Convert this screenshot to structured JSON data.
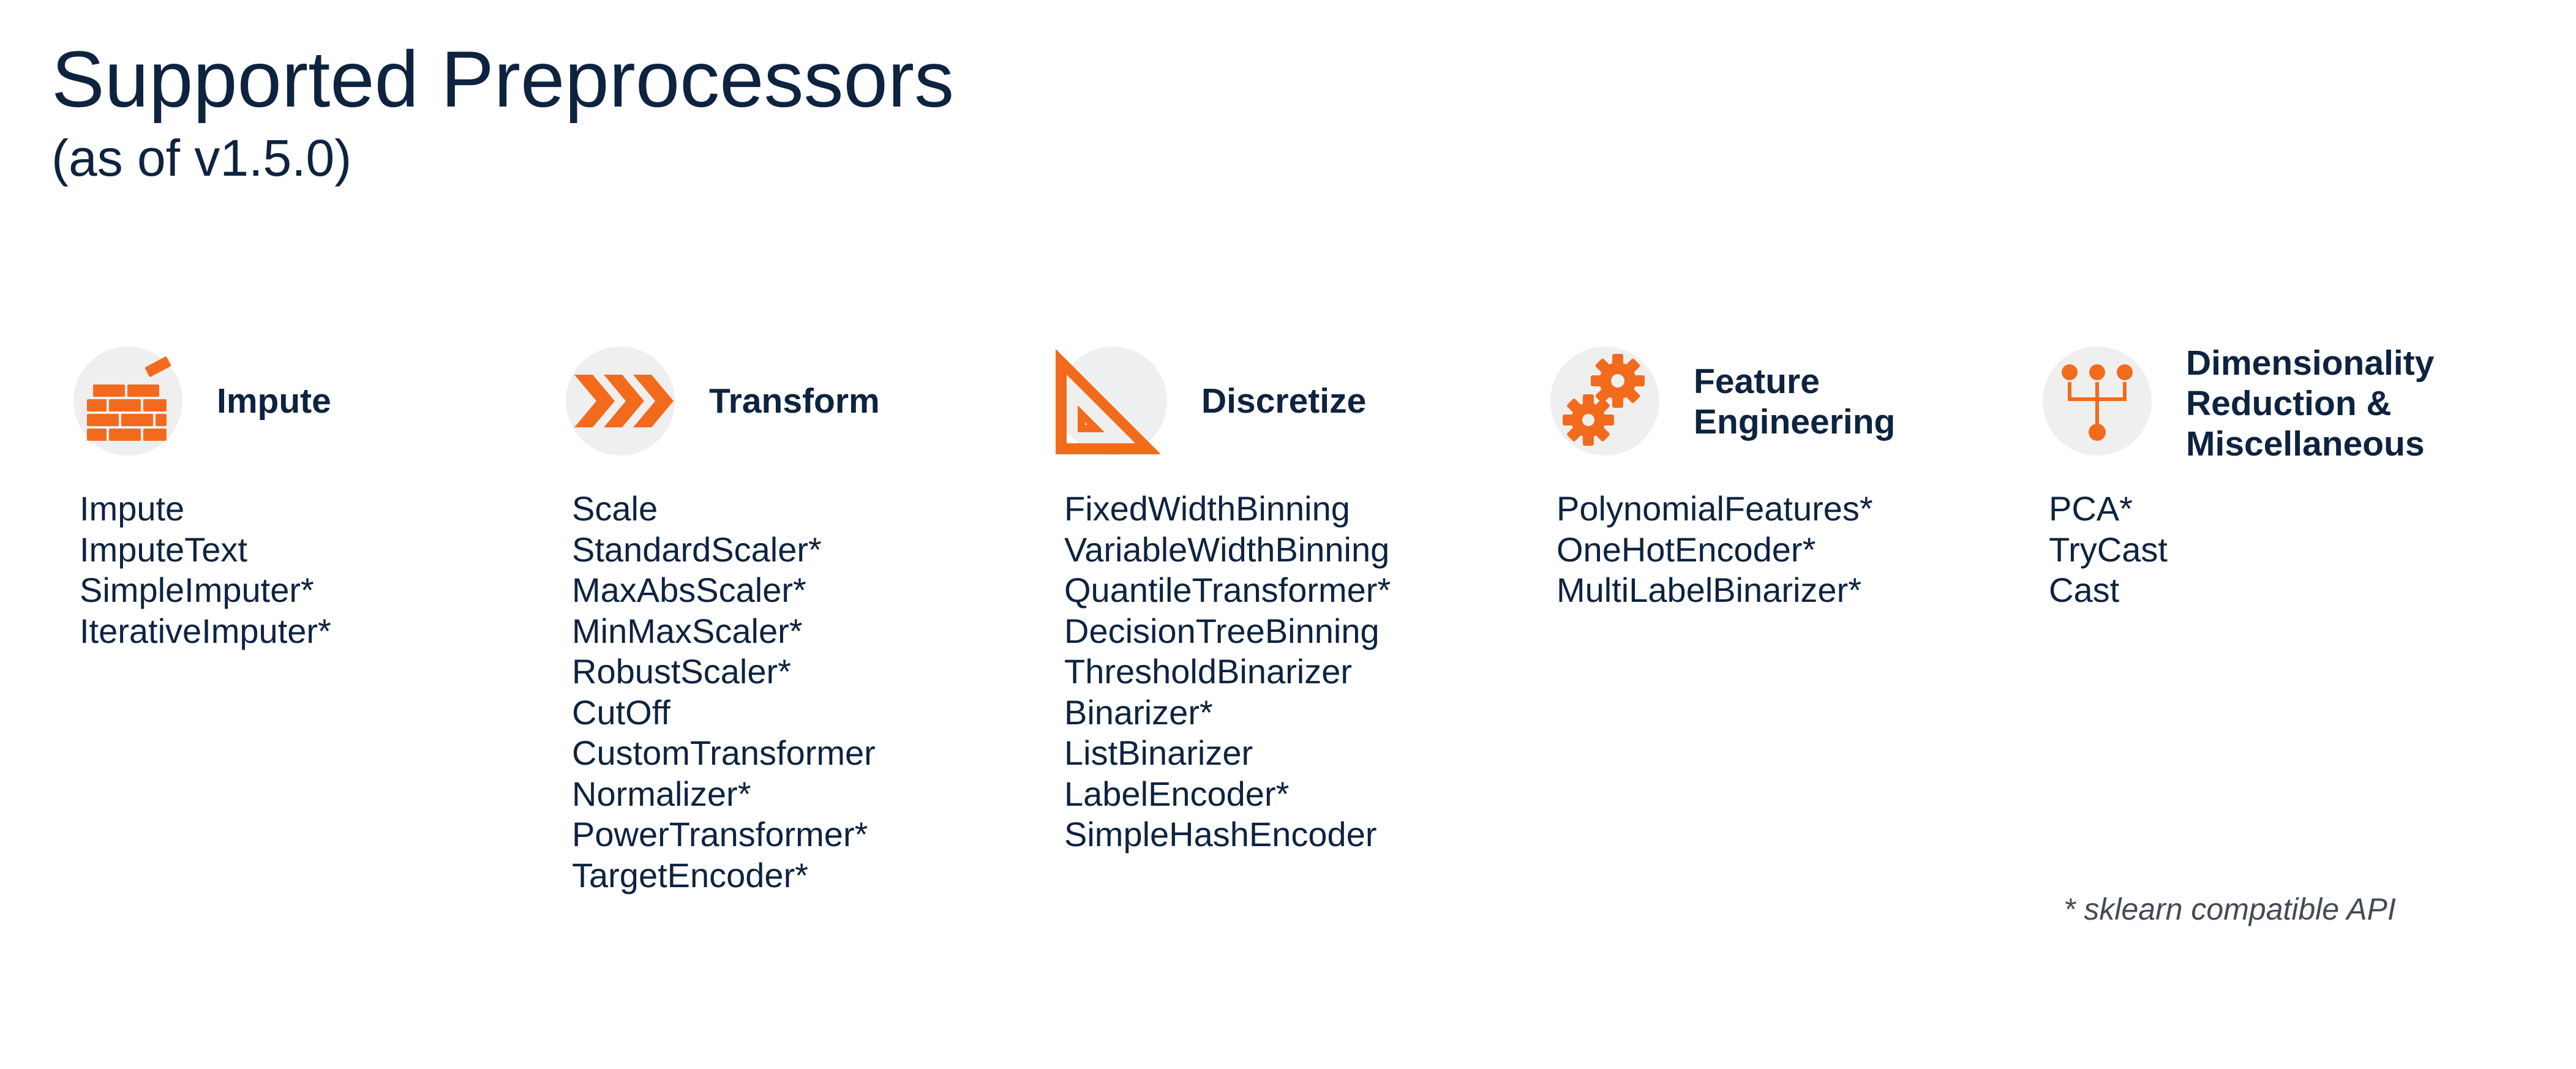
{
  "header": {
    "title": "Supported Preprocessors",
    "subtitle": "(as of v1.5.0)"
  },
  "accent_color": "#f26b1d",
  "icon_bg_color": "#efefef",
  "text_color": "#0d2340",
  "columns": [
    {
      "heading": "Impute",
      "icon": "brick-wall-icon",
      "items": [
        "Impute",
        "ImputeText",
        "SimpleImputer*",
        "IterativeImputer*"
      ]
    },
    {
      "heading": "Transform",
      "icon": "chevrons-right-icon",
      "items": [
        "Scale",
        "StandardScaler*",
        "MaxAbsScaler*",
        "MinMaxScaler*",
        "RobustScaler*",
        "CutOff",
        "CustomTransformer",
        "Normalizer*",
        "PowerTransformer*",
        "TargetEncoder*"
      ]
    },
    {
      "heading": "Discretize",
      "icon": "set-square-ruler-icon",
      "items": [
        "FixedWidthBinning",
        "VariableWidthBinning",
        "QuantileTransformer*",
        "DecisionTreeBinning",
        "ThresholdBinarizer",
        "Binarizer*",
        "ListBinarizer",
        "LabelEncoder*",
        "SimpleHashEncoder"
      ]
    },
    {
      "heading_lines": [
        "Feature",
        "Engineering"
      ],
      "icon": "gears-icon",
      "items": [
        "PolynomialFeatures*",
        "OneHotEncoder*",
        "MultiLabelBinarizer*"
      ]
    },
    {
      "heading_lines": [
        "Dimensionality",
        "Reduction &",
        "Miscellaneous"
      ],
      "icon": "merge-nodes-icon",
      "items": [
        "PCA*",
        "TryCast",
        "Cast"
      ]
    }
  ],
  "footnote": "* sklearn compatible API"
}
